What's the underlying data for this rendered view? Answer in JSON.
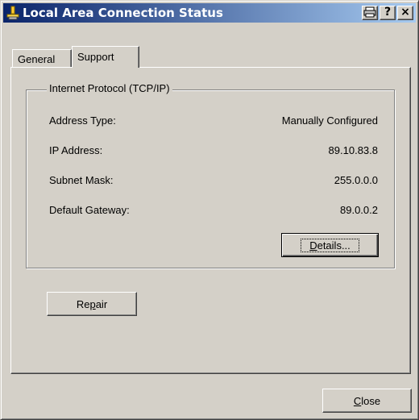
{
  "window": {
    "title": "Local Area Connection Status",
    "icon": "network-connection-icon",
    "buttons": {
      "print": "🖶",
      "help": "?",
      "close": "×"
    }
  },
  "tabs": [
    {
      "label": "General",
      "selected": false
    },
    {
      "label": "Support",
      "selected": true
    }
  ],
  "group": {
    "title": "Internet Protocol (TCP/IP)",
    "rows": [
      {
        "label": "Address Type:",
        "value": "Manually Configured"
      },
      {
        "label": "IP Address:",
        "value": "89.10.83.8"
      },
      {
        "label": "Subnet Mask:",
        "value": "255.0.0.0"
      },
      {
        "label": "Default Gateway:",
        "value": "89.0.0.2"
      }
    ],
    "details_button": {
      "pre": "",
      "accel": "D",
      "post": "etails..."
    }
  },
  "repair_button": {
    "pre": "Re",
    "accel": "p",
    "post": "air"
  },
  "close_button": {
    "pre": "",
    "accel": "C",
    "post": "lose"
  },
  "colors": {
    "titlebar_start": "#0a246a",
    "titlebar_end": "#a6caf0",
    "face": "#d4d0c8"
  }
}
